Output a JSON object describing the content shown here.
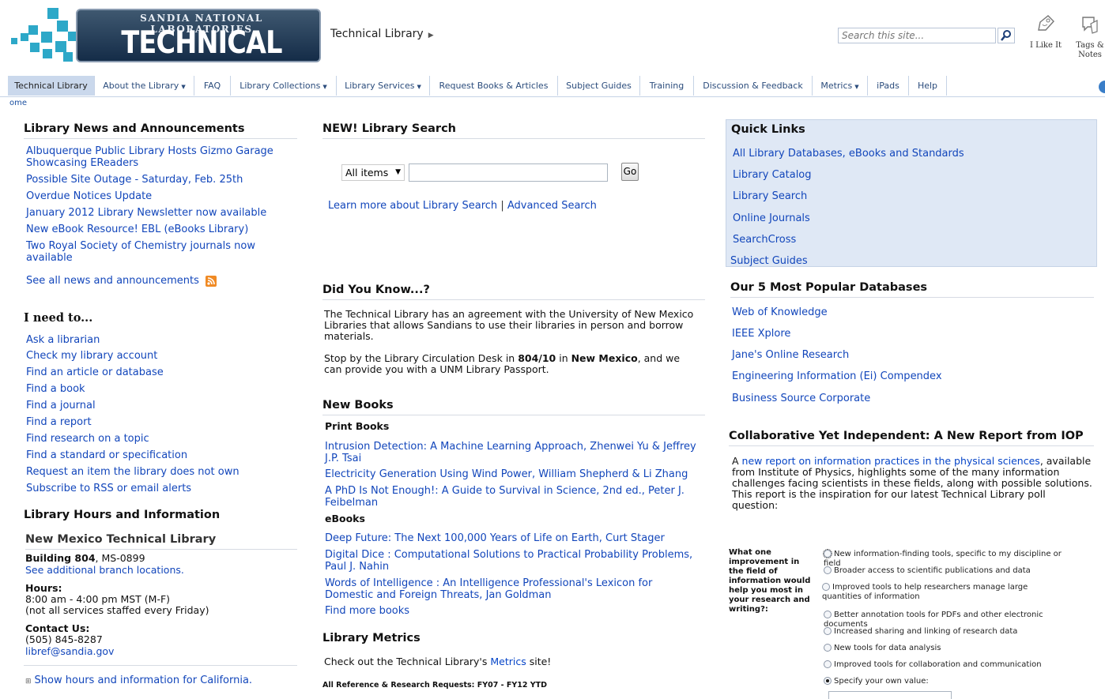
{
  "header": {
    "logo_top": "SANDIA NATIONAL LABORATORIES",
    "logo_main": "TECHNICAL LIBRARY",
    "breadcrumb": "Technical Library",
    "search_placeholder": "Search this site...",
    "like_label": "I Like It",
    "tags_label_1": "Tags &",
    "tags_label_2": "Notes",
    "brand_color": "#2da8c8"
  },
  "nav": {
    "items": [
      "Technical Library",
      "About the Library",
      "FAQ",
      "Library Collections",
      "Library Services",
      "Request Books & Articles",
      "Subject Guides",
      "Training",
      "Discussion & Feedback",
      "Metrics",
      "iPads",
      "Help"
    ],
    "sub_crumb": "ome"
  },
  "news": {
    "title": "Library News and Announcements",
    "items": [
      "Albuquerque Public Library Hosts Gizmo Garage Showcasing EReaders",
      "Possible Site Outage - Saturday, Feb. 25th",
      "Overdue Notices Update",
      "January 2012 Library Newsletter now available",
      "New eBook Resource! EBL (eBooks Library)",
      "Two Royal Society of Chemistry journals now available"
    ],
    "see_all": "See all news and announcements"
  },
  "ineed": {
    "title": "I need to...",
    "items": [
      "Ask a librarian",
      "Check my library account",
      "Find an article or database",
      "Find a book",
      "Find a journal",
      "Find a report",
      "Find research on a topic",
      "Find a standard or specification",
      "Request an item the library does not own",
      "Subscribe to RSS or email alerts"
    ]
  },
  "hours": {
    "title": "Library Hours and Information",
    "branch": "New Mexico Technical Library",
    "building_bold": "Building 804",
    "building_rest": ", MS-0899",
    "branches_link": "See additional branch locations.",
    "hours_label": "Hours:",
    "hours_1": "8:00 am - 4:00 pm MST (M-F)",
    "hours_2": "(not all services staffed every Friday)",
    "contact_label": "Contact Us:",
    "phone": "(505) 845-8287",
    "email": "libref@sandia.gov",
    "california": "Show hours and information for California."
  },
  "search": {
    "title": "NEW! Library Search",
    "scope": "All items",
    "go": "Go",
    "learn_more": "Learn more about Library Search",
    "separator": "|",
    "advanced": "Advanced Search"
  },
  "dyk": {
    "title": "Did You Know...?",
    "p1": "The Technical Library has an agreement with the University of New Mexico Libraries that allows Sandians to use their libraries in person and borrow materials.",
    "p2_a": "Stop by the Library Circulation Desk in ",
    "p2_b": "804/10",
    "p2_c": " in ",
    "p2_d": "New Mexico",
    "p2_e": ", and we can provide you with a UNM Library Passport."
  },
  "newbooks": {
    "title": "New Books",
    "print_label": "Print Books",
    "print": [
      "Intrusion Detection: A Machine Learning Approach, Zhenwei Yu & Jeffrey J.P. Tsai",
      "Electricity Generation Using Wind Power, William Shepherd & Li Zhang",
      "A PhD Is Not Enough!: A Guide to Survival in Science, 2nd ed., Peter J. Feibelman"
    ],
    "ebooks_label": "eBooks",
    "ebooks": [
      "Deep Future: The Next 100,000 Years of Life on Earth, Curt Stager",
      "Digital Dice : Computational Solutions to Practical Probability Problems, Paul J. Nahin",
      "Words of Intelligence : An Intelligence Professional's Lexicon for Domestic and Foreign Threats, Jan Goldman"
    ],
    "find_more": "Find more books"
  },
  "metrics": {
    "title": "Library Metrics",
    "text_a": "Check out the Technical Library's ",
    "link": "Metrics",
    "text_b": " site!",
    "chart_caption": "All Reference & Research Requests: FY07 - FY12 YTD"
  },
  "quick": {
    "title": "Quick Links",
    "items": [
      "All Library Databases, eBooks and Standards",
      "Library Catalog",
      "Library Search",
      "Online Journals",
      "SearchCross",
      "Subject Guides"
    ]
  },
  "popular": {
    "title": "Our 5 Most Popular Databases",
    "items": [
      "Web of Knowledge",
      "IEEE Xplore",
      "Jane's Online Research",
      "Engineering Information (Ei) Compendex",
      "Business Source Corporate"
    ]
  },
  "iop": {
    "title": "Collaborative Yet Independent: A New Report from IOP",
    "lead_a": "A ",
    "link": "new report on information practices in the physical sciences",
    "lead_b": ", available from Institute of Physics, highlights some of the many information challenges facing scientists in these fields, along with possible solutions. This report is the inspiration for our latest Technical Library poll question:"
  },
  "poll": {
    "question": "What one improvement in the field of information would help you most in your research and writing?:",
    "options": [
      "New information-finding tools, specific to my discipline or field",
      "Broader access to scientific publications and data",
      "Improved tools to help researchers manage large quantities of information",
      "Better annotation tools for PDFs and other electronic documents",
      "Increased sharing and linking of research data",
      "New tools for data analysis",
      "Improved tools for collaboration and communication",
      "Specify your own value:"
    ],
    "selected": 7
  }
}
